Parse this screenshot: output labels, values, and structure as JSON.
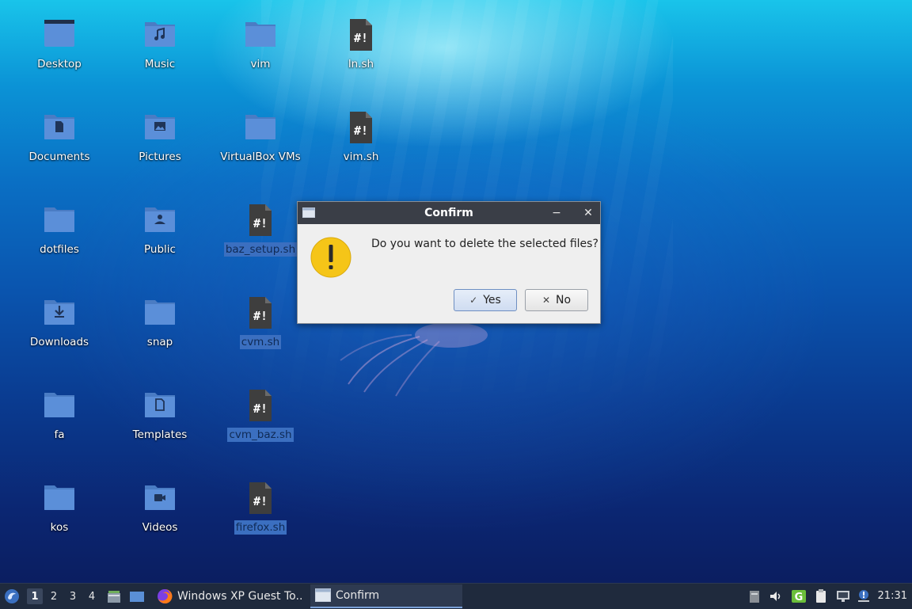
{
  "desktop": {
    "icons": [
      {
        "name": "Desktop",
        "kind": "folder-desktop",
        "selected": false
      },
      {
        "name": "Music",
        "kind": "folder-music",
        "selected": false
      },
      {
        "name": "vim",
        "kind": "folder",
        "selected": false
      },
      {
        "name": "ln.sh",
        "kind": "script",
        "selected": false
      },
      {
        "name": "Documents",
        "kind": "folder-documents",
        "selected": false
      },
      {
        "name": "Pictures",
        "kind": "folder-pictures",
        "selected": false
      },
      {
        "name": "VirtualBox VMs",
        "kind": "folder",
        "selected": false
      },
      {
        "name": "vim.sh",
        "kind": "script",
        "selected": false
      },
      {
        "name": "dotfiles",
        "kind": "folder",
        "selected": false
      },
      {
        "name": "Public",
        "kind": "folder-public",
        "selected": false
      },
      {
        "name": "baz_setup.sh",
        "kind": "script",
        "selected": true
      },
      {
        "name": "Downloads",
        "kind": "folder-downloads",
        "selected": false
      },
      {
        "name": "snap",
        "kind": "folder",
        "selected": false
      },
      {
        "name": "cvm.sh",
        "kind": "script",
        "selected": true
      },
      {
        "name": "fa",
        "kind": "folder",
        "selected": false
      },
      {
        "name": "Templates",
        "kind": "folder-templates",
        "selected": false
      },
      {
        "name": "cvm_baz.sh",
        "kind": "script",
        "selected": true
      },
      {
        "name": "kos",
        "kind": "folder",
        "selected": false
      },
      {
        "name": "Videos",
        "kind": "folder-videos",
        "selected": false
      },
      {
        "name": "firefox.sh",
        "kind": "script",
        "selected": true
      }
    ]
  },
  "dialog": {
    "title": "Confirm",
    "minimize_glyph": "−",
    "close_glyph": "✕",
    "message": "Do you want to delete the selected files?",
    "yes_label": "Yes",
    "no_label": "No",
    "yes_icon": "✓",
    "no_icon": "✕"
  },
  "taskbar": {
    "workspaces": [
      "1",
      "2",
      "3",
      "4"
    ],
    "active_workspace": "1",
    "tasks": [
      {
        "label": "Windows XP Guest To...",
        "icon": "firefox-icon",
        "active": false
      },
      {
        "label": "Confirm",
        "icon": "window-icon",
        "active": true
      }
    ],
    "clock": "21:31"
  },
  "colors": {
    "folder": "#5b8fd9",
    "script": "#3e3e3e",
    "selection": "#3b6fc0",
    "titlebar": "#3a3e47",
    "taskbar": "#1f2a3d",
    "warning": "#f5c518"
  }
}
